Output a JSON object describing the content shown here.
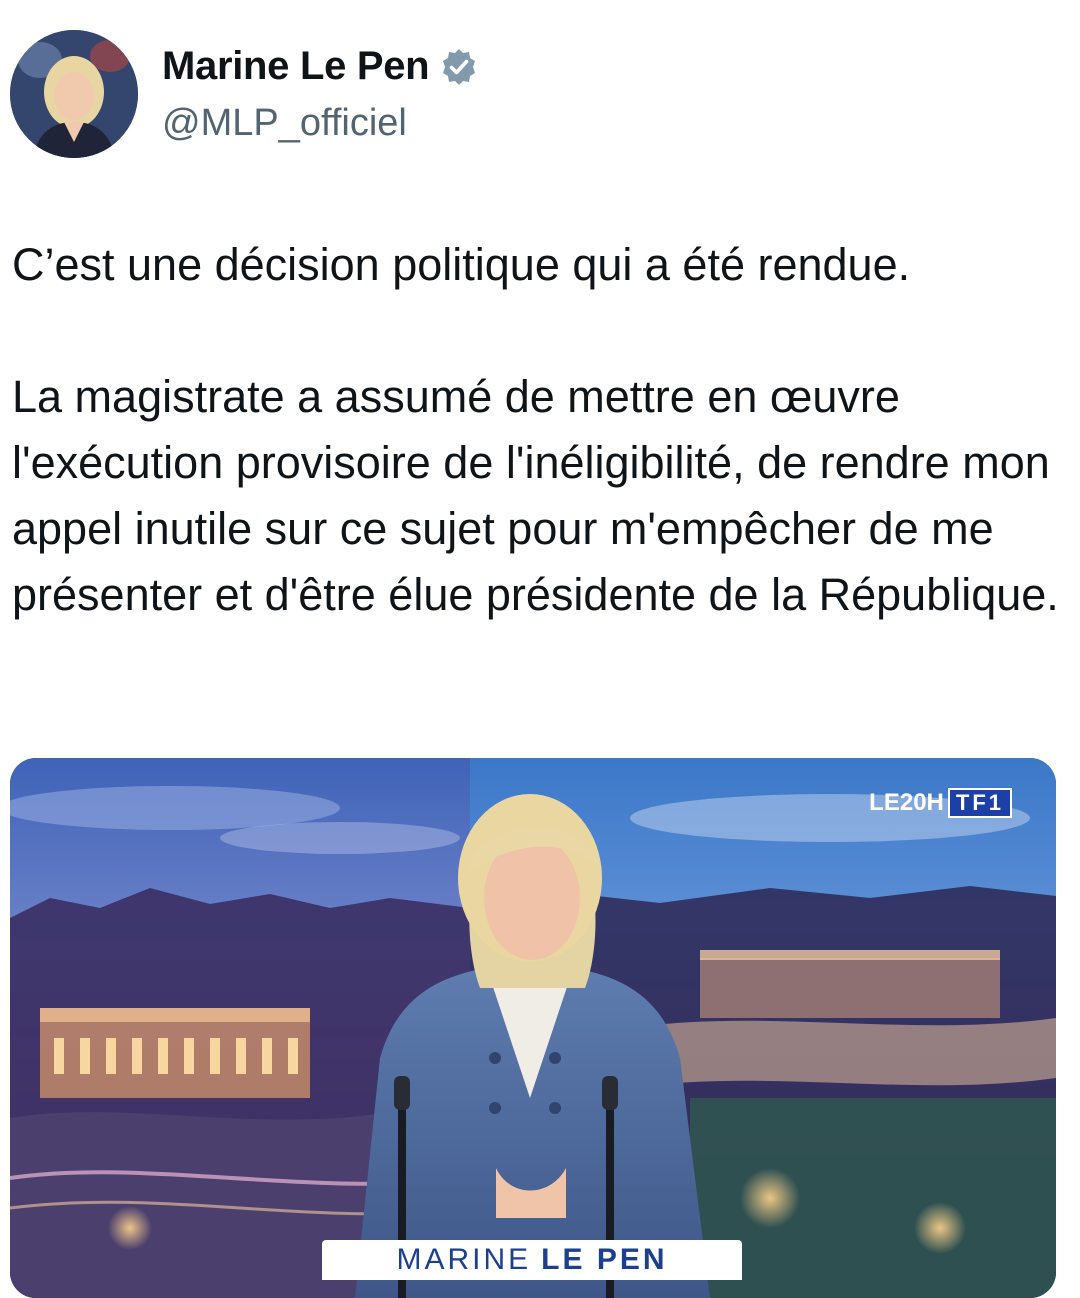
{
  "author": {
    "display_name": "Marine Le Pen",
    "handle": "@MLP_officiel",
    "verified_icon": "verified-badge-icon",
    "verified_color": "#829aab"
  },
  "tweet": {
    "paragraphs": [
      "C’est une décision politique qui a été rendue.",
      "La magistrate a assumé de mettre en œuvre l'exécution provisoire de l'inéligibilité, de rendre mon appel inutile sur ce sujet pour m'empêcher de me présenter et d'être élue présidente de la République."
    ]
  },
  "media": {
    "watermark_show": "LE20H",
    "watermark_channel": "TF1",
    "lower_third_first": "MARINE",
    "lower_third_last": "LE PEN"
  },
  "colors": {
    "text": "#0f1419",
    "secondary_text": "#536471",
    "tf1_blue": "#1d3fa8"
  }
}
